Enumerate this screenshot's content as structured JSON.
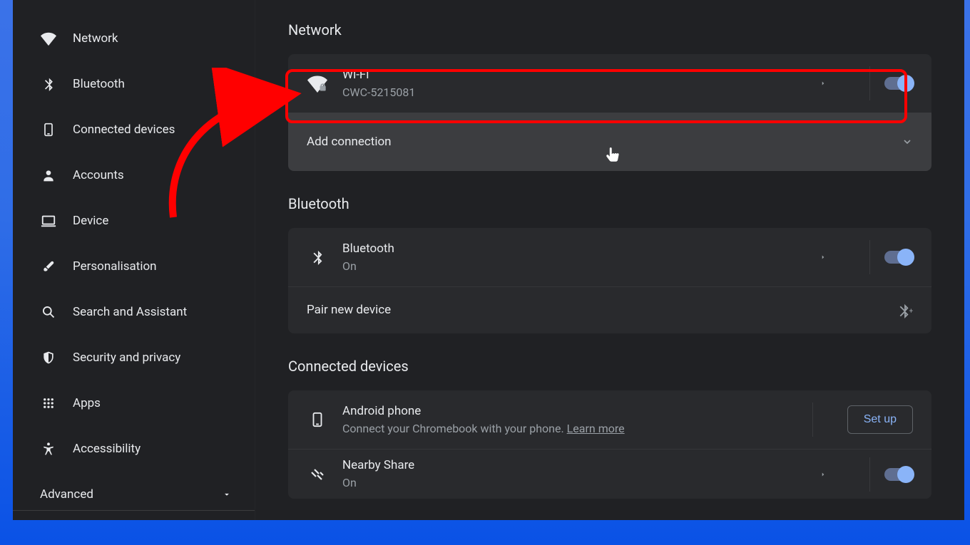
{
  "sidebar": {
    "items": [
      {
        "label": "Network"
      },
      {
        "label": "Bluetooth"
      },
      {
        "label": "Connected devices"
      },
      {
        "label": "Accounts"
      },
      {
        "label": "Device"
      },
      {
        "label": "Personalisation"
      },
      {
        "label": "Search and Assistant"
      },
      {
        "label": "Security and privacy"
      },
      {
        "label": "Apps"
      },
      {
        "label": "Accessibility"
      }
    ],
    "advanced_label": "Advanced"
  },
  "sections": {
    "network": {
      "title": "Network",
      "wifi_title": "Wi-Fi",
      "wifi_subtitle": "CWC-5215081",
      "add_connection": "Add connection"
    },
    "bluetooth": {
      "title": "Bluetooth",
      "row_title": "Bluetooth",
      "row_subtitle": "On",
      "pair_label": "Pair new device"
    },
    "connected": {
      "title": "Connected devices",
      "android_title": "Android phone",
      "android_sub_prefix": "Connect your Chromebook with your phone. ",
      "android_learn_more": "Learn more",
      "setup_label": "Set up",
      "nearby_title": "Nearby Share",
      "nearby_sub": "On"
    }
  }
}
